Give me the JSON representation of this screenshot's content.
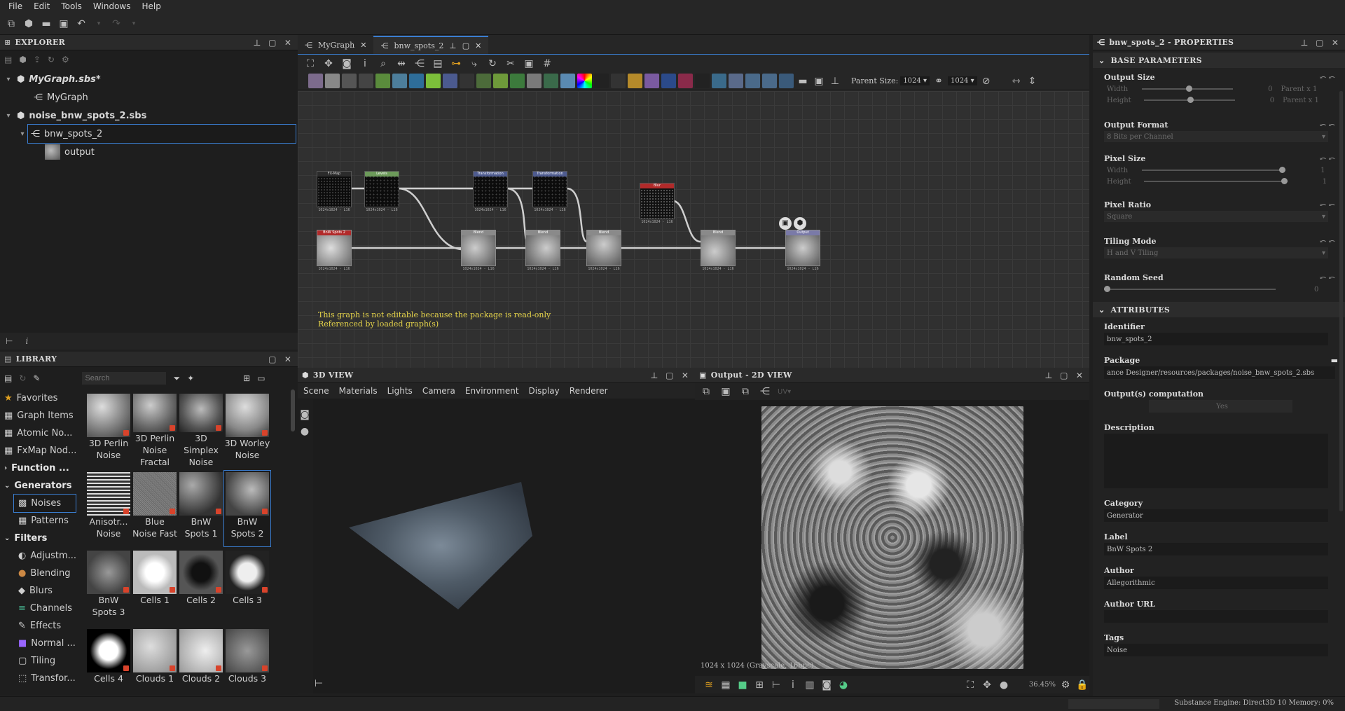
{
  "menu": [
    "File",
    "Edit",
    "Tools",
    "Windows",
    "Help"
  ],
  "explorer": {
    "title": "EXPLORER",
    "items": [
      {
        "label": "MyGraph.sbs*",
        "kind": "package"
      },
      {
        "label": "MyGraph",
        "kind": "graph"
      },
      {
        "label": "noise_bnw_spots_2.sbs",
        "kind": "package"
      },
      {
        "label": "bnw_spots_2",
        "kind": "graph"
      },
      {
        "label": "output",
        "kind": "output"
      }
    ]
  },
  "library": {
    "title": "LIBRARY",
    "search_placeholder": "Search",
    "categories": [
      "Favorites",
      "Graph Items",
      "Atomic No...",
      "FxMap Nod...",
      "Function ...",
      "Generators",
      "Noises",
      "Patterns",
      "Filters",
      "Adjustm...",
      "Blending",
      "Blurs",
      "Channels",
      "Effects",
      "Normal ...",
      "Tiling",
      "Transfor..."
    ],
    "items": [
      {
        "label": "3D Perlin Noise"
      },
      {
        "label": "3D Perlin Noise Fractal"
      },
      {
        "label": "3D Simplex Noise"
      },
      {
        "label": "3D Worley Noise"
      },
      {
        "label": "Anisotr... Noise"
      },
      {
        "label": "Blue Noise Fast"
      },
      {
        "label": "BnW Spots 1"
      },
      {
        "label": "BnW Spots 2"
      },
      {
        "label": "BnW Spots 3"
      },
      {
        "label": "Cells 1"
      },
      {
        "label": "Cells 2"
      },
      {
        "label": "Cells 3"
      },
      {
        "label": "Cells 4"
      },
      {
        "label": "Clouds 1"
      },
      {
        "label": "Clouds 2"
      },
      {
        "label": "Clouds 3"
      }
    ]
  },
  "graph": {
    "tabs": [
      "MyGraph",
      "bnw_spots_2"
    ],
    "parent_size_label": "Parent Size:",
    "parent_size_value": "1024",
    "second_size_value": "1024",
    "warning_line1": "This graph is not editable because the package is read-only",
    "warning_line2": "Referenced by loaded graph(s)",
    "node_caption": "1024x1024 - L16",
    "nodes": [
      {
        "title": "FX-Map",
        "header": "#2b2b2b"
      },
      {
        "title": "Levels",
        "header": "#6c9a5a"
      },
      {
        "title": "Transformation",
        "header": "#4e5b8f"
      },
      {
        "title": "Transformation",
        "header": "#4e5b8f"
      },
      {
        "title": "Blur",
        "header": "#b22a2a"
      },
      {
        "title": "BnW Spots 2",
        "header": "#b22a2a"
      },
      {
        "title": "Blend",
        "header": "#8a8a8a"
      },
      {
        "title": "Blend",
        "header": "#8a8a8a"
      },
      {
        "title": "Blend",
        "header": "#8a8a8a"
      },
      {
        "title": "Blend",
        "header": "#8a8a8a"
      },
      {
        "title": "Output",
        "header": "#7a7aa8"
      }
    ]
  },
  "view3d": {
    "title": "3D VIEW",
    "menu": [
      "Scene",
      "Materials",
      "Lights",
      "Camera",
      "Environment",
      "Display",
      "Renderer"
    ]
  },
  "view2d": {
    "title": "Output - 2D VIEW",
    "uv_label": "UV",
    "resolution": "1024 x 1024 (Grayscale, 16bpc)",
    "zoom": "36.45%"
  },
  "properties": {
    "title": "bnw_spots_2 - PROPERTIES",
    "base_section": "BASE PARAMETERS",
    "output_size": {
      "label": "Output Size",
      "width_label": "Width",
      "height_label": "Height",
      "width_value": "0",
      "height_value": "0",
      "width_rel": "Parent x 1",
      "height_rel": "Parent x 1"
    },
    "output_format": {
      "label": "Output Format",
      "value": "8 Bits per Channel"
    },
    "pixel_size": {
      "label": "Pixel Size",
      "width_label": "Width",
      "height_label": "Height",
      "width_value": "1",
      "height_value": "1"
    },
    "pixel_ratio": {
      "label": "Pixel Ratio",
      "value": "Square"
    },
    "tiling_mode": {
      "label": "Tiling Mode",
      "value": "H and V Tiling"
    },
    "random_seed": {
      "label": "Random Seed",
      "value": "0"
    },
    "attr_section": "ATTRIBUTES",
    "identifier": {
      "label": "Identifier",
      "value": "bnw_spots_2"
    },
    "package": {
      "label": "Package",
      "value": "ance Designer/resources/packages/noise_bnw_spots_2.sbs"
    },
    "output_computation": {
      "label": "Output(s) computation",
      "value": "Yes"
    },
    "description": {
      "label": "Description",
      "value": ""
    },
    "category": {
      "label": "Category",
      "value": "Generator"
    },
    "label_field": {
      "label": "Label",
      "value": "BnW Spots 2"
    },
    "author": {
      "label": "Author",
      "value": "Allegorithmic"
    },
    "author_url": {
      "label": "Author URL",
      "value": ""
    },
    "tags": {
      "label": "Tags",
      "value": "Noise"
    }
  },
  "status": {
    "engine": "Substance Engine: Direct3D 10 Memory: 0%"
  },
  "colors": {
    "accent": "#3a7dd0",
    "warning": "#e6d44a",
    "badge": "#d8432b"
  }
}
